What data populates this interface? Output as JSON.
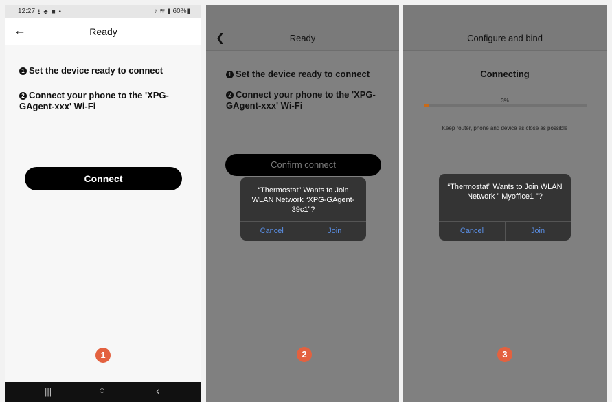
{
  "panel1": {
    "status": {
      "time": "12:27",
      "icons": "⭳ ♣ ■ •",
      "right": "♪ ≋ ▮ 60%▮"
    },
    "title": "Ready",
    "steps": [
      {
        "num": "1",
        "text": "Set the device ready to connect"
      },
      {
        "num": "2",
        "text": "Connect your phone to the 'XPG-GAgent-xxx' Wi-Fi"
      }
    ],
    "connect_button": "Connect",
    "badge": "1",
    "nav": {
      "recent": "|||",
      "home": "○",
      "back": "‹"
    }
  },
  "panel2": {
    "title": "Ready",
    "steps": [
      {
        "num": "1",
        "text": "Set the device ready to connect"
      },
      {
        "num": "2",
        "text": "Connect your phone to the 'XPG-GAgent-xxx' Wi-Fi"
      }
    ],
    "confirm_button": "Confirm connect",
    "dialog": {
      "message": "“Thermostat” Wants to Join WLAN Network “XPG-GAgent-39c1”?",
      "cancel": "Cancel",
      "join": "Join"
    },
    "badge": "2"
  },
  "panel3": {
    "title": "Configure and bind",
    "status": "Connecting",
    "progress_label": "3%",
    "progress": 0.03,
    "hint": "Keep router, phone and device as close as possible",
    "dialog": {
      "message": "“Thermostat” Wants to Join WLAN Network ” Myoffice1 ”?",
      "cancel": "Cancel",
      "join": "Join"
    },
    "badge": "3"
  },
  "colors": {
    "badge": "#e3613f",
    "ios_link": "#5a8fe6",
    "progress": "#c86a18"
  }
}
